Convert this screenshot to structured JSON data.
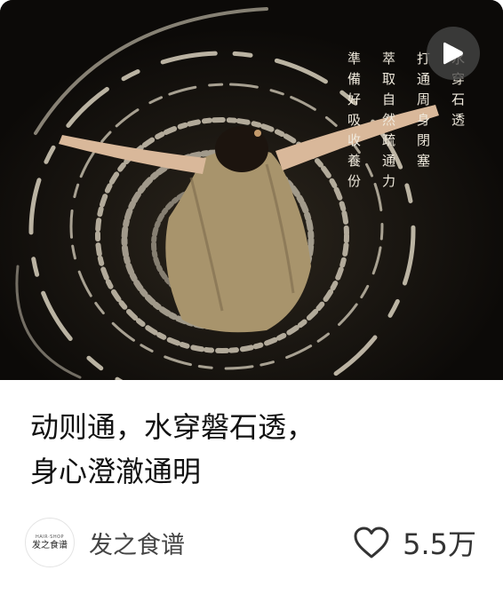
{
  "cover": {
    "poem_columns": [
      "水穿石透",
      "打通周身閉塞",
      "萃取自然疏通力",
      "準備好吸收養份"
    ]
  },
  "post": {
    "title_line1": "动则通，水穿磐石透，",
    "title_line2": "身心澄澈通明"
  },
  "author": {
    "name": "发之食谱",
    "avatar_small_text": "HAIR·SHOP",
    "avatar_main_text": "发之食谱"
  },
  "stats": {
    "likes": "5.5万"
  },
  "icons": {
    "play": "play-icon",
    "like": "heart-outline-icon"
  },
  "colors": {
    "title": "#111111",
    "meta": "#444444",
    "play_bg": "#464646"
  }
}
